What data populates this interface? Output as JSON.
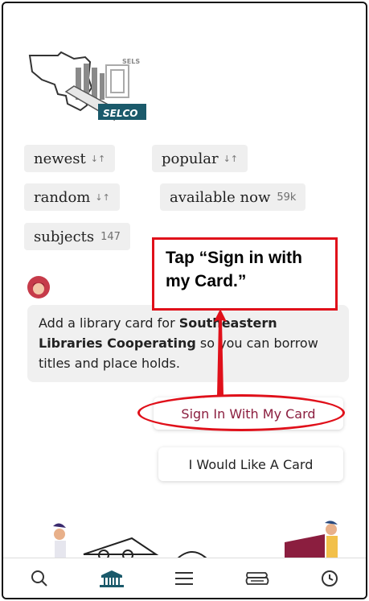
{
  "app": {
    "logo_text_top": "SELS",
    "logo_text_bottom": "SELCO"
  },
  "chips": [
    {
      "label": "newest",
      "sort": "↓↑"
    },
    {
      "label": "popular",
      "sort": "↓↑"
    },
    {
      "label": "random",
      "sort": "↓↑"
    },
    {
      "label": "available now",
      "count": "59k"
    },
    {
      "label": "subjects",
      "count": "147"
    }
  ],
  "message": {
    "prefix": "Add a library card for ",
    "library": "Southeastern Libraries Cooperating",
    "suffix": " so you can borrow titles and place holds."
  },
  "buttons": {
    "sign_in": "Sign In With My Card",
    "want_card": "I Would Like A Card"
  },
  "annotation": {
    "text": "Tap “Sign in with my Card.”",
    "color": "#e0101a"
  },
  "tabbar": {
    "icons": [
      "search-icon",
      "library-icon",
      "menu-icon",
      "shelf-icon",
      "clock-icon"
    ]
  },
  "colors": {
    "accent": "#8b1e3f",
    "chip_bg": "#efefef",
    "annotation_red": "#e0101a"
  }
}
